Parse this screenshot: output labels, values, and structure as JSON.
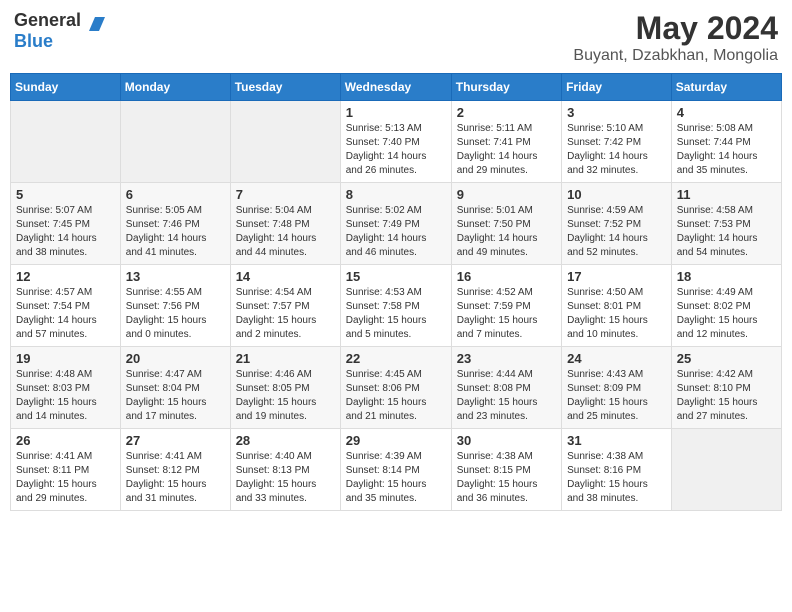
{
  "logo": {
    "general": "General",
    "blue": "Blue"
  },
  "header": {
    "month": "May 2024",
    "location": "Buyant, Dzabkhan, Mongolia"
  },
  "days_of_week": [
    "Sunday",
    "Monday",
    "Tuesday",
    "Wednesday",
    "Thursday",
    "Friday",
    "Saturday"
  ],
  "weeks": [
    [
      {
        "day": "",
        "info": ""
      },
      {
        "day": "",
        "info": ""
      },
      {
        "day": "",
        "info": ""
      },
      {
        "day": "1",
        "info": "Sunrise: 5:13 AM\nSunset: 7:40 PM\nDaylight: 14 hours and 26 minutes."
      },
      {
        "day": "2",
        "info": "Sunrise: 5:11 AM\nSunset: 7:41 PM\nDaylight: 14 hours and 29 minutes."
      },
      {
        "day": "3",
        "info": "Sunrise: 5:10 AM\nSunset: 7:42 PM\nDaylight: 14 hours and 32 minutes."
      },
      {
        "day": "4",
        "info": "Sunrise: 5:08 AM\nSunset: 7:44 PM\nDaylight: 14 hours and 35 minutes."
      }
    ],
    [
      {
        "day": "5",
        "info": "Sunrise: 5:07 AM\nSunset: 7:45 PM\nDaylight: 14 hours and 38 minutes."
      },
      {
        "day": "6",
        "info": "Sunrise: 5:05 AM\nSunset: 7:46 PM\nDaylight: 14 hours and 41 minutes."
      },
      {
        "day": "7",
        "info": "Sunrise: 5:04 AM\nSunset: 7:48 PM\nDaylight: 14 hours and 44 minutes."
      },
      {
        "day": "8",
        "info": "Sunrise: 5:02 AM\nSunset: 7:49 PM\nDaylight: 14 hours and 46 minutes."
      },
      {
        "day": "9",
        "info": "Sunrise: 5:01 AM\nSunset: 7:50 PM\nDaylight: 14 hours and 49 minutes."
      },
      {
        "day": "10",
        "info": "Sunrise: 4:59 AM\nSunset: 7:52 PM\nDaylight: 14 hours and 52 minutes."
      },
      {
        "day": "11",
        "info": "Sunrise: 4:58 AM\nSunset: 7:53 PM\nDaylight: 14 hours and 54 minutes."
      }
    ],
    [
      {
        "day": "12",
        "info": "Sunrise: 4:57 AM\nSunset: 7:54 PM\nDaylight: 14 hours and 57 minutes."
      },
      {
        "day": "13",
        "info": "Sunrise: 4:55 AM\nSunset: 7:56 PM\nDaylight: 15 hours and 0 minutes."
      },
      {
        "day": "14",
        "info": "Sunrise: 4:54 AM\nSunset: 7:57 PM\nDaylight: 15 hours and 2 minutes."
      },
      {
        "day": "15",
        "info": "Sunrise: 4:53 AM\nSunset: 7:58 PM\nDaylight: 15 hours and 5 minutes."
      },
      {
        "day": "16",
        "info": "Sunrise: 4:52 AM\nSunset: 7:59 PM\nDaylight: 15 hours and 7 minutes."
      },
      {
        "day": "17",
        "info": "Sunrise: 4:50 AM\nSunset: 8:01 PM\nDaylight: 15 hours and 10 minutes."
      },
      {
        "day": "18",
        "info": "Sunrise: 4:49 AM\nSunset: 8:02 PM\nDaylight: 15 hours and 12 minutes."
      }
    ],
    [
      {
        "day": "19",
        "info": "Sunrise: 4:48 AM\nSunset: 8:03 PM\nDaylight: 15 hours and 14 minutes."
      },
      {
        "day": "20",
        "info": "Sunrise: 4:47 AM\nSunset: 8:04 PM\nDaylight: 15 hours and 17 minutes."
      },
      {
        "day": "21",
        "info": "Sunrise: 4:46 AM\nSunset: 8:05 PM\nDaylight: 15 hours and 19 minutes."
      },
      {
        "day": "22",
        "info": "Sunrise: 4:45 AM\nSunset: 8:06 PM\nDaylight: 15 hours and 21 minutes."
      },
      {
        "day": "23",
        "info": "Sunrise: 4:44 AM\nSunset: 8:08 PM\nDaylight: 15 hours and 23 minutes."
      },
      {
        "day": "24",
        "info": "Sunrise: 4:43 AM\nSunset: 8:09 PM\nDaylight: 15 hours and 25 minutes."
      },
      {
        "day": "25",
        "info": "Sunrise: 4:42 AM\nSunset: 8:10 PM\nDaylight: 15 hours and 27 minutes."
      }
    ],
    [
      {
        "day": "26",
        "info": "Sunrise: 4:41 AM\nSunset: 8:11 PM\nDaylight: 15 hours and 29 minutes."
      },
      {
        "day": "27",
        "info": "Sunrise: 4:41 AM\nSunset: 8:12 PM\nDaylight: 15 hours and 31 minutes."
      },
      {
        "day": "28",
        "info": "Sunrise: 4:40 AM\nSunset: 8:13 PM\nDaylight: 15 hours and 33 minutes."
      },
      {
        "day": "29",
        "info": "Sunrise: 4:39 AM\nSunset: 8:14 PM\nDaylight: 15 hours and 35 minutes."
      },
      {
        "day": "30",
        "info": "Sunrise: 4:38 AM\nSunset: 8:15 PM\nDaylight: 15 hours and 36 minutes."
      },
      {
        "day": "31",
        "info": "Sunrise: 4:38 AM\nSunset: 8:16 PM\nDaylight: 15 hours and 38 minutes."
      },
      {
        "day": "",
        "info": ""
      }
    ]
  ]
}
